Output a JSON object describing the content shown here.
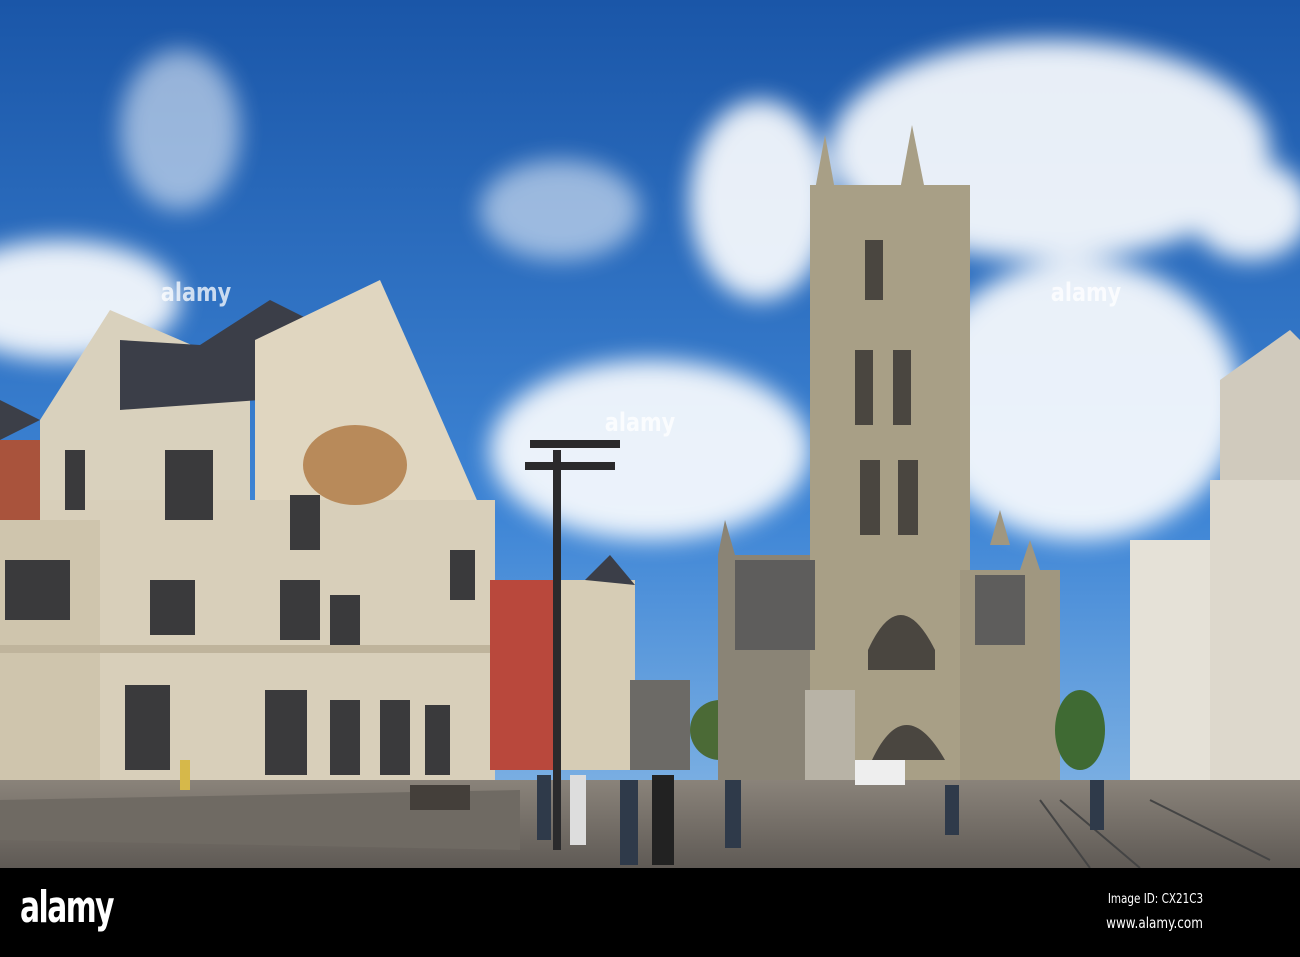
{
  "photo": {
    "subject": "Gent square with theatre and cathedral tower",
    "colors": {
      "sky_top": "#1f5fb0",
      "sky_bottom": "#5c9de0",
      "stone": "#b7ab8c",
      "pavement": "#77716a"
    }
  },
  "watermark": {
    "text": "alamy"
  },
  "footer": {
    "logo": "alamy",
    "image_id": "Image ID: CX21C3",
    "website": "www.alamy.com"
  }
}
